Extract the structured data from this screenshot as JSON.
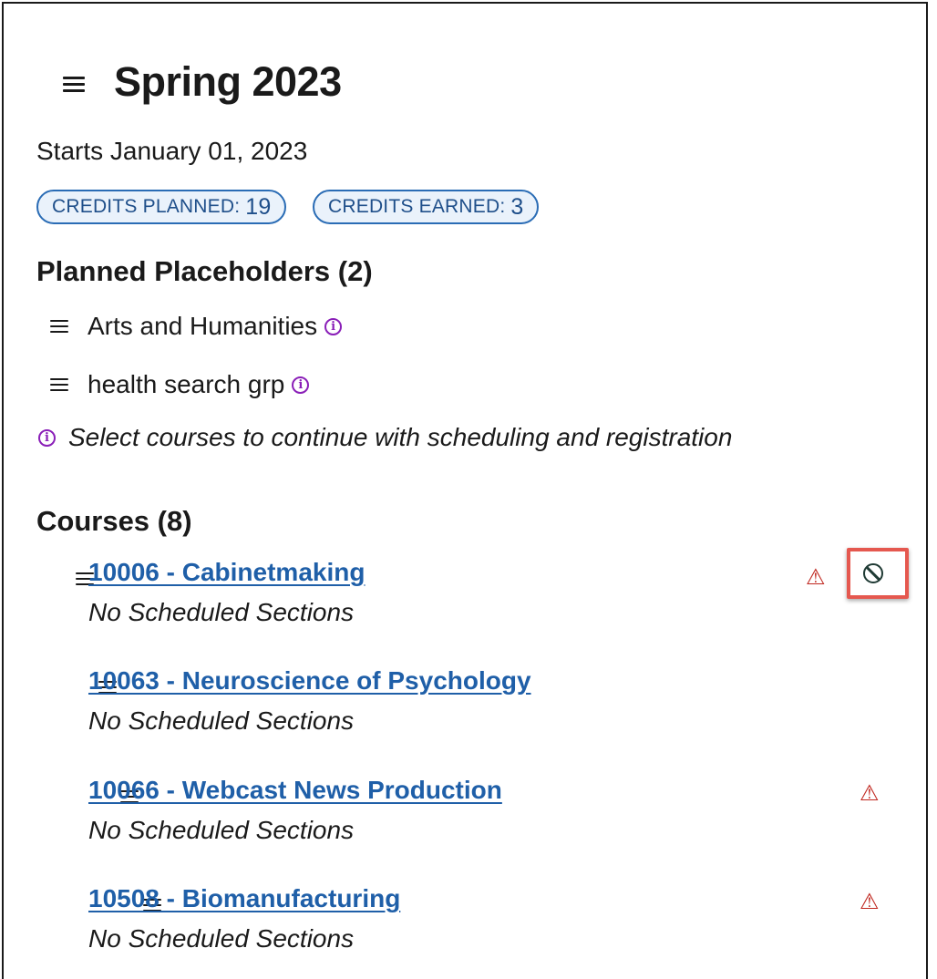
{
  "term": {
    "title": "Spring 2023",
    "start_text": "Starts January 01, 2023",
    "credits_planned_label": "CREDITS PLANNED:",
    "credits_planned_value": "19",
    "credits_earned_label": "CREDITS EARNED:",
    "credits_earned_value": "3"
  },
  "placeholders": {
    "heading": "Planned Placeholders (2)",
    "items": [
      {
        "label": "Arts and Humanities",
        "icon": "info-icon"
      },
      {
        "label": "health search grp",
        "icon": "info-icon"
      }
    ],
    "note": "Select courses to continue with scheduling and registration"
  },
  "courses": {
    "heading": "Courses (8)",
    "items": [
      {
        "title": "10006 - Cabinetmaking",
        "status": "No Scheduled Sections",
        "warning": true,
        "blocked": true
      },
      {
        "title": "10063 - Neuroscience of Psychology",
        "status": "No Scheduled Sections",
        "warning": false,
        "blocked": false
      },
      {
        "title": "10066 - Webcast News Production",
        "status": "No Scheduled Sections",
        "warning": true,
        "blocked": false
      },
      {
        "title": "10508 - Biomanufacturing",
        "status": "No Scheduled Sections",
        "warning": true,
        "blocked": false
      }
    ]
  },
  "colors": {
    "link": "#1f5fa8",
    "warning": "#c0271f",
    "info": "#8a1fb8",
    "pill_border": "#2a6cb5",
    "highlight": "#e5584f"
  }
}
